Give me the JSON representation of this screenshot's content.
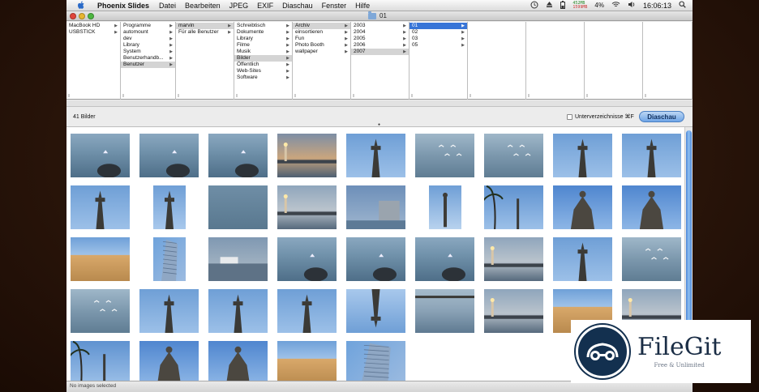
{
  "menubar": {
    "app_name": "Phoenix Slides",
    "items": [
      "Datei",
      "Bearbeiten",
      "JPEG",
      "EXIF",
      "Diaschau",
      "Fenster",
      "Hilfe"
    ],
    "mem_top": "452MB",
    "mem_bottom": "1599MB",
    "battery": "4%",
    "clock": "16:06:13"
  },
  "window": {
    "title": "01"
  },
  "columns": [
    {
      "rows": [
        {
          "label": "MacBook HD",
          "arrow": true,
          "state": ""
        },
        {
          "label": "USBSTICK",
          "arrow": true,
          "state": ""
        }
      ]
    },
    {
      "rows": [
        {
          "label": "Programme",
          "arrow": true,
          "state": ""
        },
        {
          "label": "automount",
          "arrow": true,
          "state": ""
        },
        {
          "label": "dev",
          "arrow": true,
          "state": ""
        },
        {
          "label": "Library",
          "arrow": true,
          "state": ""
        },
        {
          "label": "System",
          "arrow": true,
          "state": ""
        },
        {
          "label": "Benutzerhandb...",
          "arrow": true,
          "state": ""
        },
        {
          "label": "Benutzer",
          "arrow": true,
          "state": "gray"
        }
      ]
    },
    {
      "rows": [
        {
          "label": "marvin",
          "arrow": true,
          "state": "gray"
        },
        {
          "label": "Für alle Benutzer",
          "arrow": true,
          "state": ""
        }
      ]
    },
    {
      "rows": [
        {
          "label": "Schreibtisch",
          "arrow": true,
          "state": ""
        },
        {
          "label": "Dokumente",
          "arrow": true,
          "state": ""
        },
        {
          "label": "Library",
          "arrow": true,
          "state": ""
        },
        {
          "label": "Filme",
          "arrow": true,
          "state": ""
        },
        {
          "label": "Musik",
          "arrow": true,
          "state": ""
        },
        {
          "label": "Bilder",
          "arrow": true,
          "state": "gray"
        },
        {
          "label": "Öffentlich",
          "arrow": true,
          "state": ""
        },
        {
          "label": "Web-Sites",
          "arrow": true,
          "state": ""
        },
        {
          "label": "Software",
          "arrow": true,
          "state": ""
        }
      ]
    },
    {
      "rows": [
        {
          "label": "Archiv",
          "arrow": true,
          "state": "gray"
        },
        {
          "label": "einsortieren",
          "arrow": true,
          "state": ""
        },
        {
          "label": "Fun",
          "arrow": true,
          "state": ""
        },
        {
          "label": "Photo Booth",
          "arrow": true,
          "state": ""
        },
        {
          "label": "wallpaper",
          "arrow": true,
          "state": ""
        }
      ]
    },
    {
      "rows": [
        {
          "label": "2003",
          "arrow": true,
          "state": ""
        },
        {
          "label": "2004",
          "arrow": true,
          "state": ""
        },
        {
          "label": "2005",
          "arrow": true,
          "state": ""
        },
        {
          "label": "2006",
          "arrow": true,
          "state": ""
        },
        {
          "label": "2007",
          "arrow": true,
          "state": "gray"
        }
      ]
    },
    {
      "rows": [
        {
          "label": "01",
          "arrow": true,
          "state": "blue"
        },
        {
          "label": "02",
          "arrow": true,
          "state": ""
        },
        {
          "label": "03",
          "arrow": true,
          "state": ""
        },
        {
          "label": "05",
          "arrow": true,
          "state": ""
        }
      ]
    },
    {
      "rows": []
    },
    {
      "rows": []
    },
    {
      "rows": []
    },
    {
      "rows": []
    }
  ],
  "toolbar": {
    "count": "41 Bilder",
    "subdirs_label": "Unterverzeichnisse ⌘F",
    "slideshow_label": "Diaschau"
  },
  "status": {
    "text": "No images selected"
  },
  "colors": {
    "selection_blue": "#3875d7",
    "accent": "#4a86d8"
  },
  "thumbnails": [
    "sea-rock",
    "sea-rock",
    "sea-rock",
    "harbor-sunset",
    "tower",
    "sea-birds",
    "sea-birds",
    "tower",
    "tower",
    "tower",
    "tower-narrow",
    "sea",
    "harbor-lighthouse",
    "building",
    "column",
    "palm-tower",
    "sculpture",
    "sculpture",
    "building-warm",
    "skyscraper",
    "ship-harbor",
    "sea-rock",
    "sea-rock",
    "sea-rock",
    "harbor-lighthouse",
    "tower",
    "sea-birds",
    "sea-birds",
    "tower",
    "tower",
    "tower",
    "tower-upside",
    "sea-pier",
    "harbor-lighthouse",
    "building-warm",
    "harbor-lighthouse",
    "palm-tower",
    "sculpture",
    "sculpture",
    "building-warm",
    "skyscraper"
  ],
  "watermark": {
    "name": "FileGit",
    "tagline": "Free & Unlimited"
  }
}
